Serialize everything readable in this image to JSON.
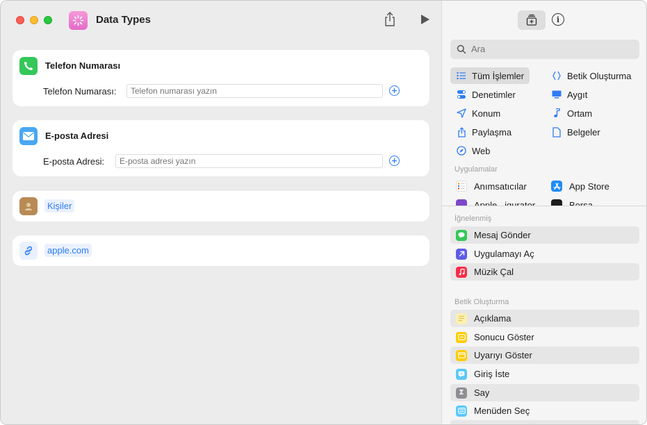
{
  "window": {
    "title": "Data Types"
  },
  "cards": {
    "phone": {
      "title": "Telefon Numarası",
      "label": "Telefon Numarası:",
      "placeholder": "Telefon numarası yazın"
    },
    "email": {
      "title": "E-posta Adresi",
      "label": "E-posta Adresi:",
      "placeholder": "E-posta adresi yazın"
    },
    "contacts": {
      "value": "Kişiler"
    },
    "url": {
      "value": "apple.com"
    }
  },
  "sidebar": {
    "search_placeholder": "Ara",
    "categories": [
      {
        "label": "Tüm İşlemler",
        "icon": "list-icon"
      },
      {
        "label": "Betik Oluşturma",
        "icon": "script-icon"
      },
      {
        "label": "Denetimler",
        "icon": "toggle-icon"
      },
      {
        "label": "Aygıt",
        "icon": "display-icon"
      },
      {
        "label": "Konum",
        "icon": "location-arrow-icon"
      },
      {
        "label": "Ortam",
        "icon": "music-note-icon"
      },
      {
        "label": "Paylaşma",
        "icon": "share-icon"
      },
      {
        "label": "Belgeler",
        "icon": "document-icon"
      },
      {
        "label": "Web",
        "icon": "compass-icon"
      }
    ],
    "apps_header": "Uygulamalar",
    "apps": [
      {
        "label": "Anımsatıcılar"
      },
      {
        "label": "App Store"
      },
      {
        "label": "Apple...igurator"
      },
      {
        "label": "Borsa"
      }
    ],
    "pinned_header": "İğnelenmiş",
    "pinned": [
      {
        "label": "Mesaj Gönder",
        "color": "#34c759"
      },
      {
        "label": "Uygulamayı Aç",
        "color": "#5e5ce6"
      },
      {
        "label": "Müzik Çal",
        "color": "#fa2d48"
      }
    ],
    "scripting_header": "Betik Oluşturma",
    "scripting": [
      {
        "label": "Açıklama",
        "color": "#f5e58a"
      },
      {
        "label": "Sonucu Göster",
        "color": "#ffcc00"
      },
      {
        "label": "Uyarıyı Göster",
        "color": "#ffcc00"
      },
      {
        "label": "Giriş İste",
        "color": "#5ac8fa"
      },
      {
        "label": "Say",
        "color": "#8e8e93"
      },
      {
        "label": "Menüden Seç",
        "color": "#5ac8fa"
      }
    ]
  },
  "colors": {
    "accent": "#2f7cf6",
    "app_icon": "#e56ac8"
  }
}
